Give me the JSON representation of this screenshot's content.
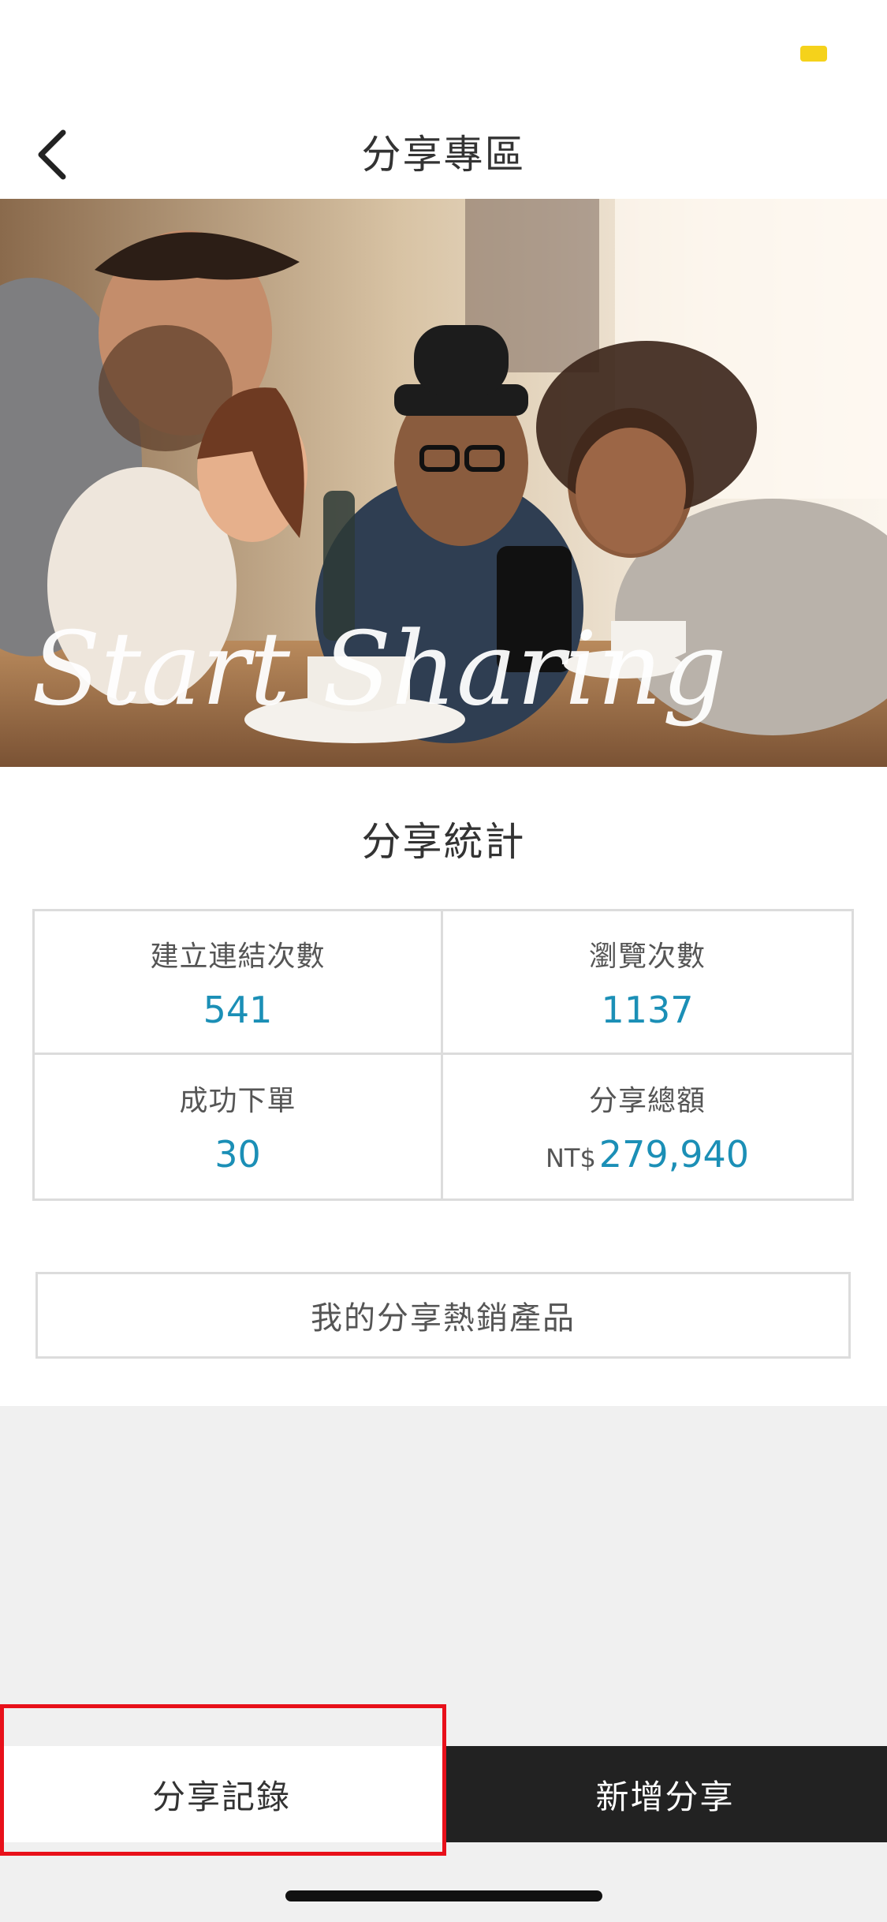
{
  "nav": {
    "title": "分享專區"
  },
  "hero": {
    "caption": "Start Sharing"
  },
  "stats": {
    "title": "分享統計",
    "items": [
      {
        "label": "建立連結次數",
        "prefix": "",
        "value": "541"
      },
      {
        "label": "瀏覽次數",
        "prefix": "",
        "value": "1137"
      },
      {
        "label": "成功下單",
        "prefix": "",
        "value": "30"
      },
      {
        "label": "分享總額",
        "prefix": "NT$",
        "value": "279,940"
      }
    ]
  },
  "hot_products_label": "我的分享熱銷產品",
  "bottom_tabs": {
    "records_label": "分享記錄",
    "add_label": "新增分享"
  },
  "colors": {
    "value_accent": "#1b8fb6",
    "battery": "#f5d21b",
    "highlight": "#e8101a",
    "dark_tab": "#222222"
  },
  "icons": [
    "back-chevron-icon",
    "battery-icon"
  ]
}
